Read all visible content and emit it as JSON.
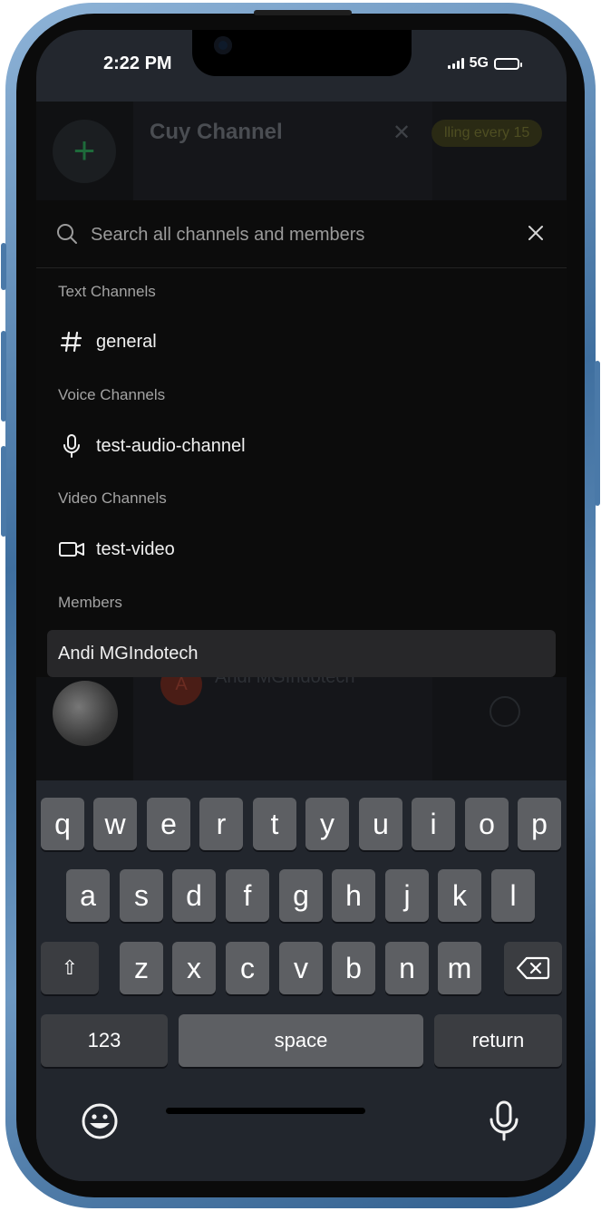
{
  "status_bar": {
    "time": "2:22 PM",
    "network": "5G"
  },
  "background_app": {
    "channel_title": "Cuy Channel",
    "add_label": "+",
    "pill_text": "lling every 15",
    "member_initial": "A",
    "member_name": "Andi MGIndotech"
  },
  "search": {
    "placeholder": "Search all channels and members",
    "value": ""
  },
  "groups": {
    "text": {
      "label": "Text Channels",
      "items": [
        {
          "name": "general",
          "icon": "hash-icon"
        }
      ]
    },
    "voice": {
      "label": "Voice Channels",
      "items": [
        {
          "name": "test-audio-channel",
          "icon": "microphone-icon"
        }
      ]
    },
    "video": {
      "label": "Video Channels",
      "items": [
        {
          "name": "test-video",
          "icon": "video-camera-icon"
        }
      ]
    },
    "members": {
      "label": "Members",
      "items": [
        {
          "name": "Andi MGIndotech"
        }
      ]
    }
  },
  "keyboard": {
    "row1": [
      "q",
      "w",
      "e",
      "r",
      "t",
      "y",
      "u",
      "i",
      "o",
      "p"
    ],
    "row2": [
      "a",
      "s",
      "d",
      "f",
      "g",
      "h",
      "j",
      "k",
      "l"
    ],
    "row3": [
      "z",
      "x",
      "c",
      "v",
      "b",
      "n",
      "m"
    ],
    "shift": "⇧",
    "numbers": "123",
    "space": "space",
    "return": "return"
  },
  "colors": {
    "palette_bg": "#0c0c0c",
    "keyboard_bg": "#22262d",
    "key_bg": "#5d5f63",
    "frame": "#3f6f9f"
  }
}
